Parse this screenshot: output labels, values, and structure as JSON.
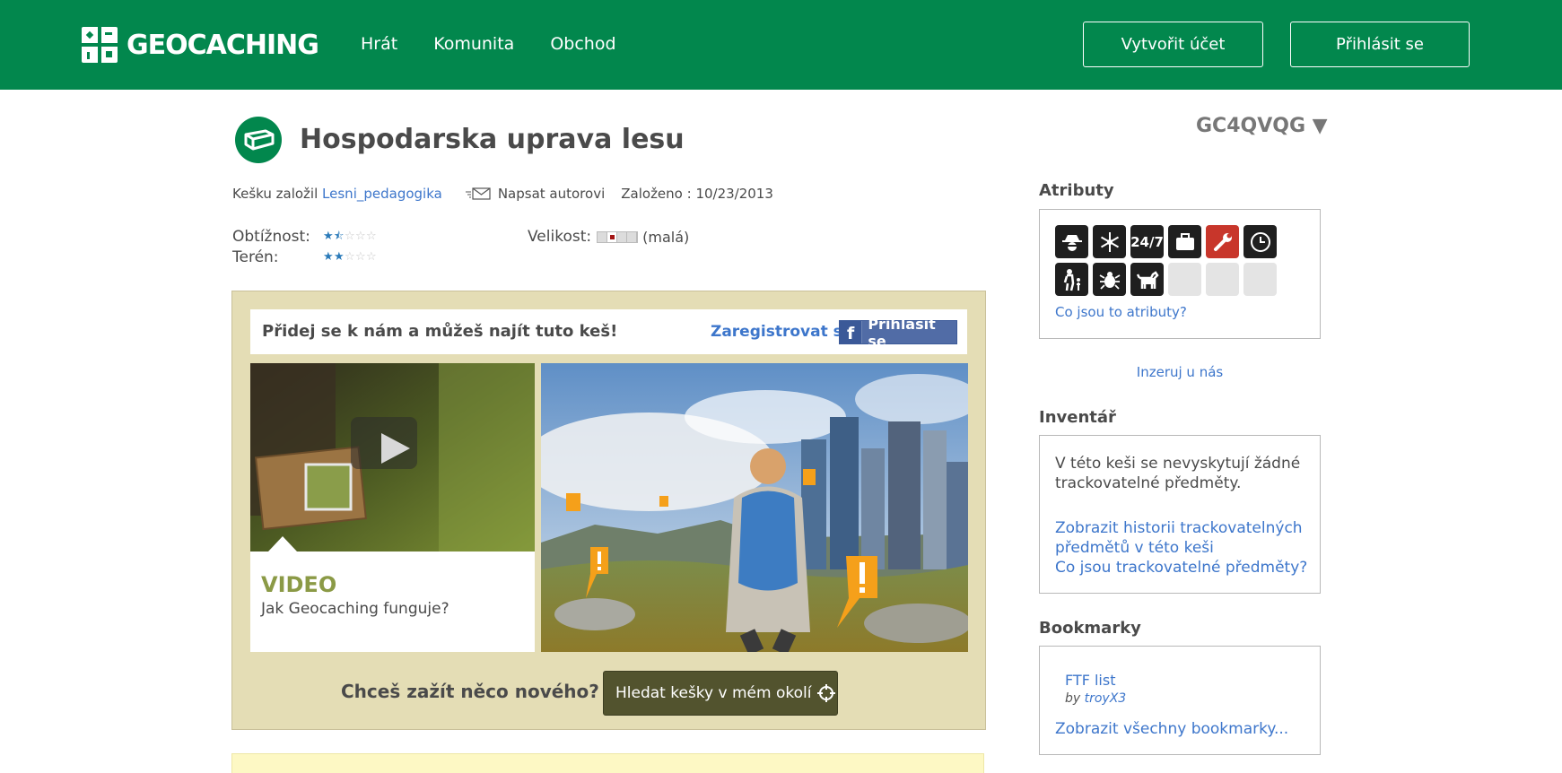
{
  "header": {
    "logo_text": "GEOCACHING",
    "nav": [
      "Hrát",
      "Komunita",
      "Obchod"
    ],
    "create_account": "Vytvořit účet",
    "sign_in": "Přihlásit se",
    "bg_color": "#02874d"
  },
  "cache": {
    "title": "Hospodarska uprava lesu",
    "code": "GC4QVQG ▼",
    "owner_prefix": "Kešku založil",
    "owner": "Lesni_pedagogika",
    "message_owner": "Napsat autorovi",
    "placed": "Založeno : 10/23/2013",
    "difficulty_label": "Obtížnost:",
    "difficulty": 1.5,
    "terrain_label": "Terén:",
    "terrain": 2,
    "size_label": "Velikost:",
    "size_text": "(malá)",
    "size_level": 2
  },
  "promo": {
    "join": "Přidej se k nám a můžeš najít tuto keš!",
    "register": "Zaregistrovat se",
    "fb_login": "Přihlásit se",
    "video_title": "VIDEO",
    "video_sub": "Jak Geocaching funguje?",
    "cta": "Chceš zažít něco nového?",
    "find_button": "Hledat kešky v mém okolí"
  },
  "sidebar": {
    "attributes_heading": "Atributy",
    "attributes": [
      "stealth-icon",
      "winter-icon",
      "247-icon",
      "equipment-icon",
      "maintenance-icon",
      "time-icon",
      "kids-icon",
      "ticks-icon",
      "dogs-icon",
      "blank",
      "blank",
      "blank"
    ],
    "attribute_247": "24/7",
    "attributes_link": "Co jsou to atributy?",
    "advertise": "Inzeruj u nás",
    "inventory_heading": "Inventář",
    "inventory_text": "V této keši se nevyskytují žádné trackovatelné předměty.",
    "inventory_history": "Zobrazit historii trackovatelných předmětů v této keši",
    "inventory_what": "Co jsou trackovatelné předměty?",
    "bookmarks_heading": "Bookmarky",
    "bookmark_title": "FTF list",
    "bookmark_by": "by",
    "bookmark_user": "troyX3",
    "bookmarks_all": "Zobrazit všechny bookmarky..."
  }
}
